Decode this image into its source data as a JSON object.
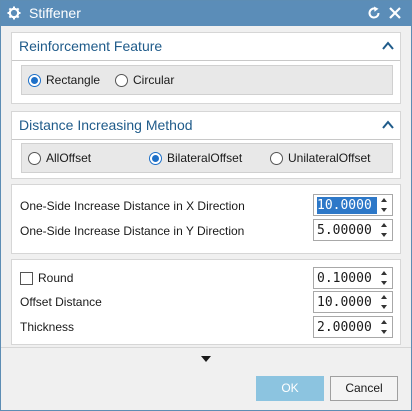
{
  "window": {
    "title": "Stiffener",
    "gear_icon": "gear-icon",
    "reset_icon": "reset-icon",
    "close_icon": "close-icon",
    "titlebar_color": "#5b8db8"
  },
  "reinforcement": {
    "title": "Reinforcement Feature",
    "options": [
      {
        "label": "Rectangle",
        "selected": true
      },
      {
        "label": "Circular",
        "selected": false
      }
    ]
  },
  "distance_method": {
    "title": "Distance Increasing Method",
    "options": [
      {
        "label": "AllOffset",
        "selected": false
      },
      {
        "label": "BilateralOffset",
        "selected": true
      },
      {
        "label": "UnilateralOffset",
        "selected": false
      }
    ]
  },
  "increase": {
    "x_label": "One-Side Increase Distance in X Direction",
    "x_value": "10.0000",
    "y_label": "One-Side Increase Distance in Y Direction",
    "y_value": "5.00000"
  },
  "params": {
    "round_label": "Round",
    "round_checked": false,
    "round_value": "0.10000",
    "offset_label": "Offset Distance",
    "offset_value": "10.0000",
    "thickness_label": "Thickness",
    "thickness_value": "2.00000"
  },
  "buttons": {
    "ok": "OK",
    "cancel": "Cancel"
  },
  "colors": {
    "accent": "#1e70c8",
    "section_title": "#1f5b8a",
    "ok_button": "#8cc4e0"
  }
}
